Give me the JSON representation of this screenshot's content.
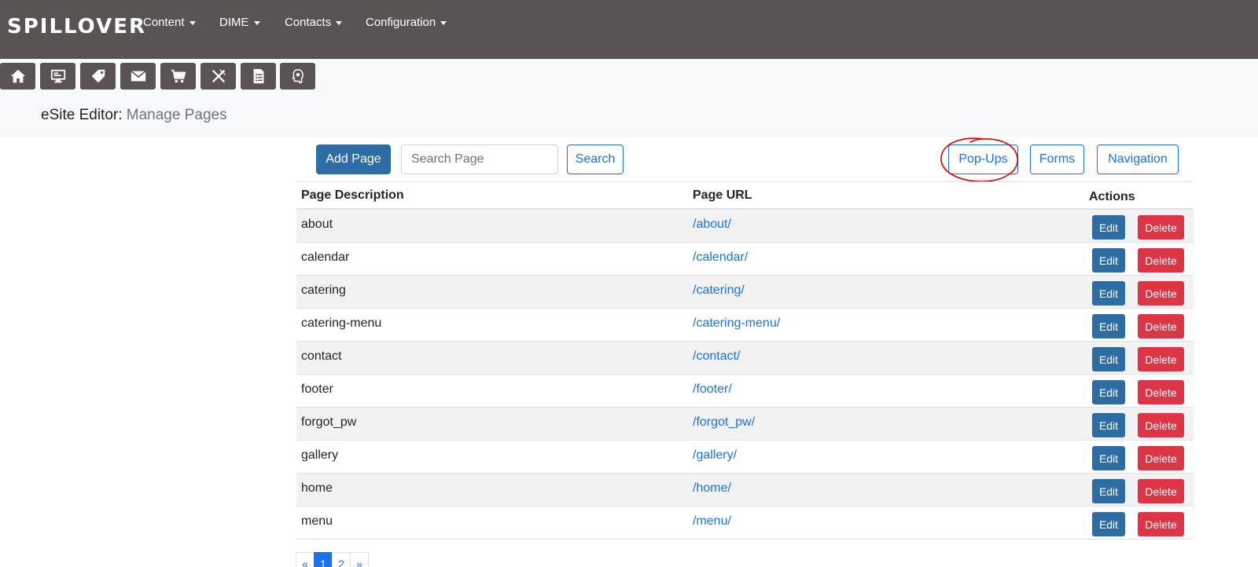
{
  "brand": {
    "logo_text": "SPILLOVER"
  },
  "nav": {
    "items": [
      {
        "label": "Content"
      },
      {
        "label": "DIME"
      },
      {
        "label": "Contacts"
      },
      {
        "label": "Configuration"
      }
    ]
  },
  "quick_icons": [
    "home-icon",
    "monitor-icon",
    "tag-icon",
    "envelope-icon",
    "cart-icon",
    "utensils-icon",
    "checklist-icon",
    "lightbulb-head-icon"
  ],
  "header": {
    "app": "eSite Editor:",
    "section": "Manage Pages"
  },
  "toolbar": {
    "add_label": "Add Page",
    "search_placeholder": "Search Page",
    "search_value": "",
    "search_label": "Search",
    "popups_label": "Pop-Ups",
    "forms_label": "Forms",
    "navigation_label": "Navigation"
  },
  "table": {
    "columns": {
      "desc": "Page Description",
      "url": "Page URL",
      "actions": "Actions"
    },
    "edit_label": "Edit",
    "delete_label": "Delete",
    "rows": [
      {
        "desc": "about",
        "url": "/about/"
      },
      {
        "desc": "calendar",
        "url": "/calendar/"
      },
      {
        "desc": "catering",
        "url": "/catering/"
      },
      {
        "desc": "catering-menu",
        "url": "/catering-menu/"
      },
      {
        "desc": "contact",
        "url": "/contact/"
      },
      {
        "desc": "footer",
        "url": "/footer/"
      },
      {
        "desc": "forgot_pw",
        "url": "/forgot_pw/"
      },
      {
        "desc": "gallery",
        "url": "/gallery/"
      },
      {
        "desc": "home",
        "url": "/home/"
      },
      {
        "desc": "menu",
        "url": "/menu/"
      }
    ]
  },
  "pagination": {
    "prev": "«",
    "pages": [
      "1",
      "2"
    ],
    "current": "1",
    "next": "»"
  },
  "colors": {
    "navbar": "#595453",
    "primary": "#2e6da4",
    "danger": "#dc3545",
    "link": "#1a73e8",
    "annotation": "#e00000"
  }
}
